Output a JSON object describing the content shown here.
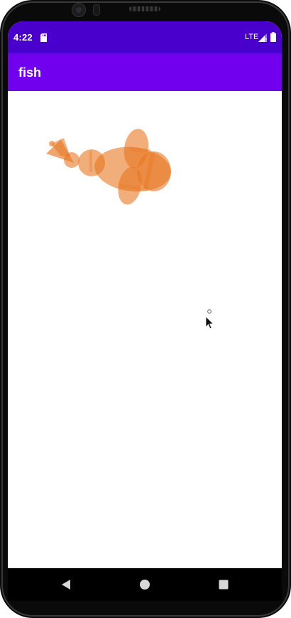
{
  "status_bar": {
    "time": "4:22",
    "network": "LTE",
    "background_color": "#4a00cc",
    "icons": [
      "sd-card-icon",
      "signal-icon",
      "battery-icon"
    ]
  },
  "app_bar": {
    "title": "fish",
    "background_color": "#7000ee"
  },
  "canvas": {
    "background_color": "#ffffff",
    "fish_color": "#e87722",
    "content": "fish-drawing"
  },
  "nav_bar": {
    "icons": [
      "back-icon",
      "home-icon",
      "recents-icon"
    ]
  }
}
